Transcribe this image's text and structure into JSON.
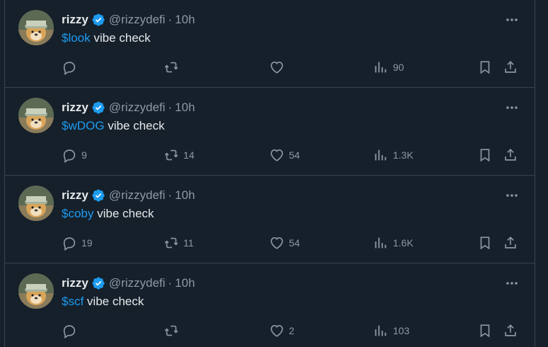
{
  "tweets": [
    {
      "name": "rizzy",
      "handle": "@rizzydefi",
      "separator": "·",
      "time": "10h",
      "cashtag": "$look",
      "text": " vibe check",
      "replies": "",
      "retweets": "",
      "likes": "",
      "views": "90"
    },
    {
      "name": "rizzy",
      "handle": "@rizzydefi",
      "separator": "·",
      "time": "10h",
      "cashtag": "$wDOG",
      "text": " vibe check",
      "replies": "9",
      "retweets": "14",
      "likes": "54",
      "views": "1.3K"
    },
    {
      "name": "rizzy",
      "handle": "@rizzydefi",
      "separator": "·",
      "time": "10h",
      "cashtag": "$coby",
      "text": " vibe check",
      "replies": "19",
      "retweets": "11",
      "likes": "54",
      "views": "1.6K"
    },
    {
      "name": "rizzy",
      "handle": "@rizzydefi",
      "separator": "·",
      "time": "10h",
      "cashtag": "$scf",
      "text": " vibe check",
      "replies": "",
      "retweets": "",
      "likes": "2",
      "views": "103"
    }
  ],
  "icons": {
    "verified": "verified-badge-icon",
    "more": "more-icon",
    "reply": "reply-icon",
    "retweet": "retweet-icon",
    "like": "heart-icon",
    "views": "views-icon",
    "bookmark": "bookmark-icon",
    "share": "share-icon"
  },
  "colors": {
    "background": "#15202b",
    "accent": "#1d9bf0",
    "muted": "#8b98a5",
    "text": "#e7e9ea",
    "border": "#38444d"
  }
}
